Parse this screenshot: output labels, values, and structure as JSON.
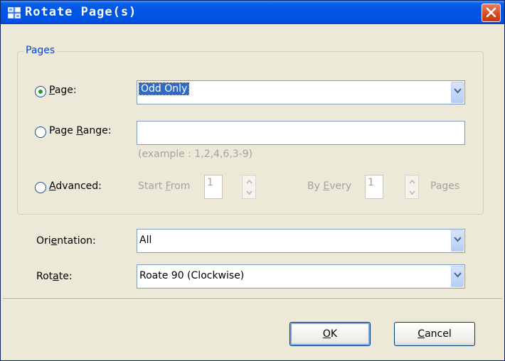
{
  "window": {
    "title": "Rotate Page(s)"
  },
  "pages_group": {
    "legend": "Pages",
    "page_option": {
      "label_u": "P",
      "label_rest": "age:",
      "selected": true,
      "combo_value": "Odd Only"
    },
    "range_option": {
      "label_pre": "Page ",
      "label_u": "R",
      "label_rest": "ange:",
      "selected": false,
      "input_value": "",
      "example": "(example : 1,2,4,6,3-9)"
    },
    "advanced_option": {
      "label_u": "A",
      "label_rest": "dvanced:",
      "selected": false,
      "start_pre": "Start ",
      "start_u": "F",
      "start_rest": "rom",
      "start_value": "1",
      "every_pre": "By ",
      "every_u": "E",
      "every_rest": "very",
      "every_value": "1",
      "pages_label": "Pages"
    }
  },
  "orientation": {
    "label_pre": "Ori",
    "label_u": "e",
    "label_rest": "ntation:",
    "value": "All"
  },
  "rotate": {
    "label_pre": "Rot",
    "label_u": "a",
    "label_rest": "te:",
    "value": "Roate 90 (Clockwise)"
  },
  "buttons": {
    "ok_u": "O",
    "ok_rest": "K",
    "cancel_u": "C",
    "cancel_rest": "ancel"
  },
  "colors": {
    "titlebar": "#0054e3",
    "dialog_bg": "#ece9d8",
    "legend": "#0046d5",
    "selection": "#316ac5"
  },
  "icons": [
    "app-icon",
    "close-icon",
    "chevron-down-icon",
    "spin-up-icon",
    "spin-down-icon"
  ]
}
